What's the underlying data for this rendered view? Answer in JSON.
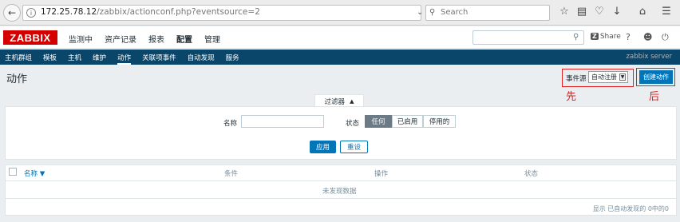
{
  "browser": {
    "url_host": "172.25.78.12",
    "url_path": "/zabbix/actionconf.php?eventsource=2",
    "search_placeholder": "Search"
  },
  "header": {
    "logo": "ZABBIX",
    "menu": [
      "监测中",
      "资产记录",
      "报表",
      "配置",
      "管理"
    ],
    "active_menu": "配置",
    "share_label": "Share",
    "help": "?"
  },
  "submenu": {
    "items": [
      "主机群组",
      "模板",
      "主机",
      "维护",
      "动作",
      "关联项事件",
      "自动发现",
      "服务"
    ],
    "active": "动作",
    "server_name": "zabbix server"
  },
  "page": {
    "title": "动作",
    "event_source_label": "事件源",
    "event_source_value": "自动注册",
    "create_button": "创建动作",
    "annotation_first": "先",
    "annotation_later": "后"
  },
  "filter": {
    "tab_label": "过滤器",
    "name_label": "名称",
    "name_value": "",
    "status_label": "状态",
    "status_options": [
      "任何",
      "已启用",
      "停用的"
    ],
    "status_selected": "任何",
    "apply_button": "应用",
    "reset_button": "重设"
  },
  "table": {
    "columns": [
      "名称 ▼",
      "条件",
      "操作",
      "状态"
    ],
    "empty_text": "未发现数据",
    "footer": "显示 已自动发现的 0中的0"
  },
  "colors": {
    "brand": "#d40000",
    "submenu_bg": "#0a466a",
    "primary": "#0275b8",
    "annotation": "#e02020"
  }
}
